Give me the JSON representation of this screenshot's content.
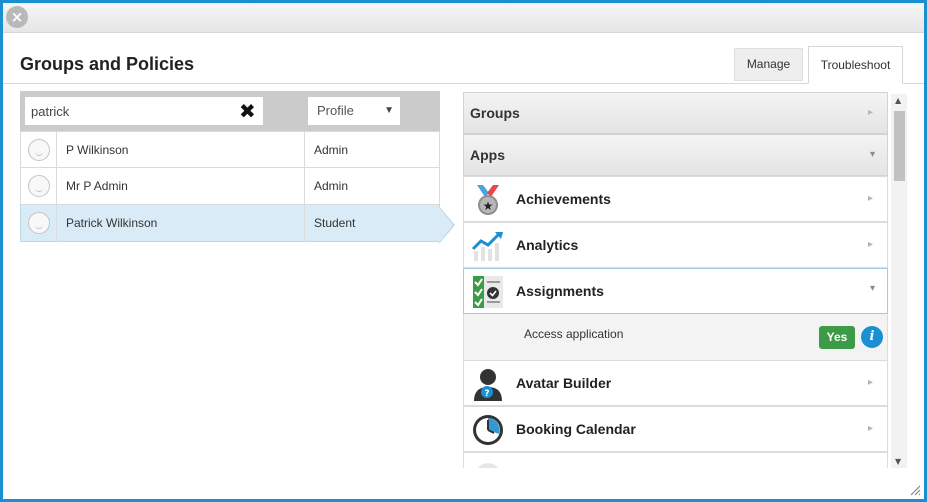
{
  "window": {
    "close_symbol": "×"
  },
  "header": {
    "title": "Groups and Policies",
    "tabs": [
      {
        "label": "Manage",
        "active": false
      },
      {
        "label": "Troubleshoot",
        "active": true
      }
    ]
  },
  "search": {
    "value": "patrick",
    "clear_icon": "✖",
    "profile_filter": "Profile",
    "profile_caret": "▼"
  },
  "users": [
    {
      "name": "P Wilkinson",
      "role": "Admin",
      "selected": false
    },
    {
      "name": "Mr P Admin",
      "role": "Admin",
      "selected": false
    },
    {
      "name": "Patrick Wilkinson",
      "role": "Student",
      "selected": true
    }
  ],
  "sections": {
    "groups_label": "Groups",
    "apps_label": "Apps"
  },
  "apps": [
    {
      "name": "Achievements",
      "icon": "medal-icon",
      "expanded": false
    },
    {
      "name": "Analytics",
      "icon": "chart-icon",
      "expanded": false
    },
    {
      "name": "Assignments",
      "icon": "checklist-icon",
      "expanded": true
    },
    {
      "name": "Avatar Builder",
      "icon": "avatar-person-icon",
      "expanded": false
    },
    {
      "name": "Booking Calendar",
      "icon": "clock-icon",
      "expanded": false
    }
  ],
  "assignments_policy": {
    "label": "Access application",
    "value": "Yes",
    "info_symbol": "i"
  },
  "chevrons": {
    "right": "▸",
    "down": "▾",
    "up": "▲",
    "dn": "▼"
  },
  "colors": {
    "accent": "#1a8fd1",
    "yes_green": "#3d9b47",
    "selected_row": "#d9ebf6"
  }
}
